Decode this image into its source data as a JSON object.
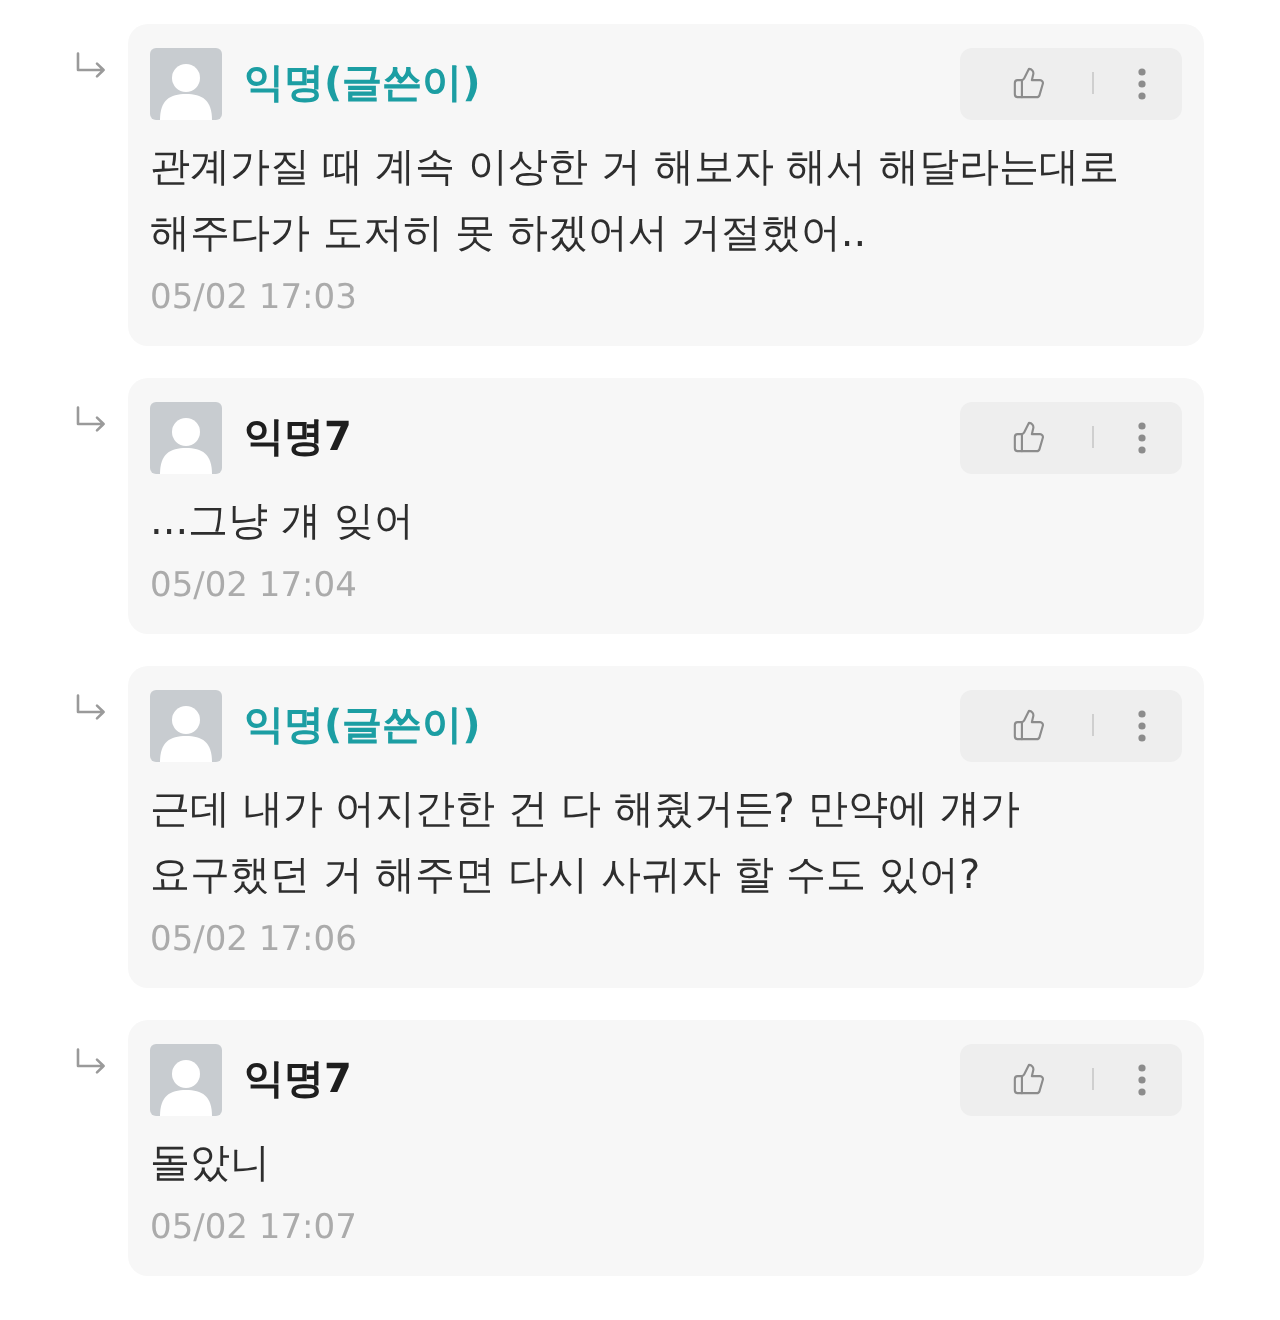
{
  "comments": [
    {
      "author": "익명(글쓴이)",
      "is_author": true,
      "text": "관계가질 때 계속 이상한 거 해보자 해서 해달라는대로 해주다가 도저히 못 하겠어서 거절했어..",
      "time": "05/02 17:03"
    },
    {
      "author": "익명7",
      "is_author": false,
      "text": "...그냥 걔 잊어",
      "time": "05/02 17:04"
    },
    {
      "author": "익명(글쓴이)",
      "is_author": true,
      "text": "근데 내가 어지간한 건 다 해줬거든? 만약에 걔가 요구했던 거 해주면 다시 사귀자 할 수도 있어?",
      "time": "05/02 17:06"
    },
    {
      "author": "익명7",
      "is_author": false,
      "text": "돌았니",
      "time": "05/02 17:07"
    }
  ]
}
